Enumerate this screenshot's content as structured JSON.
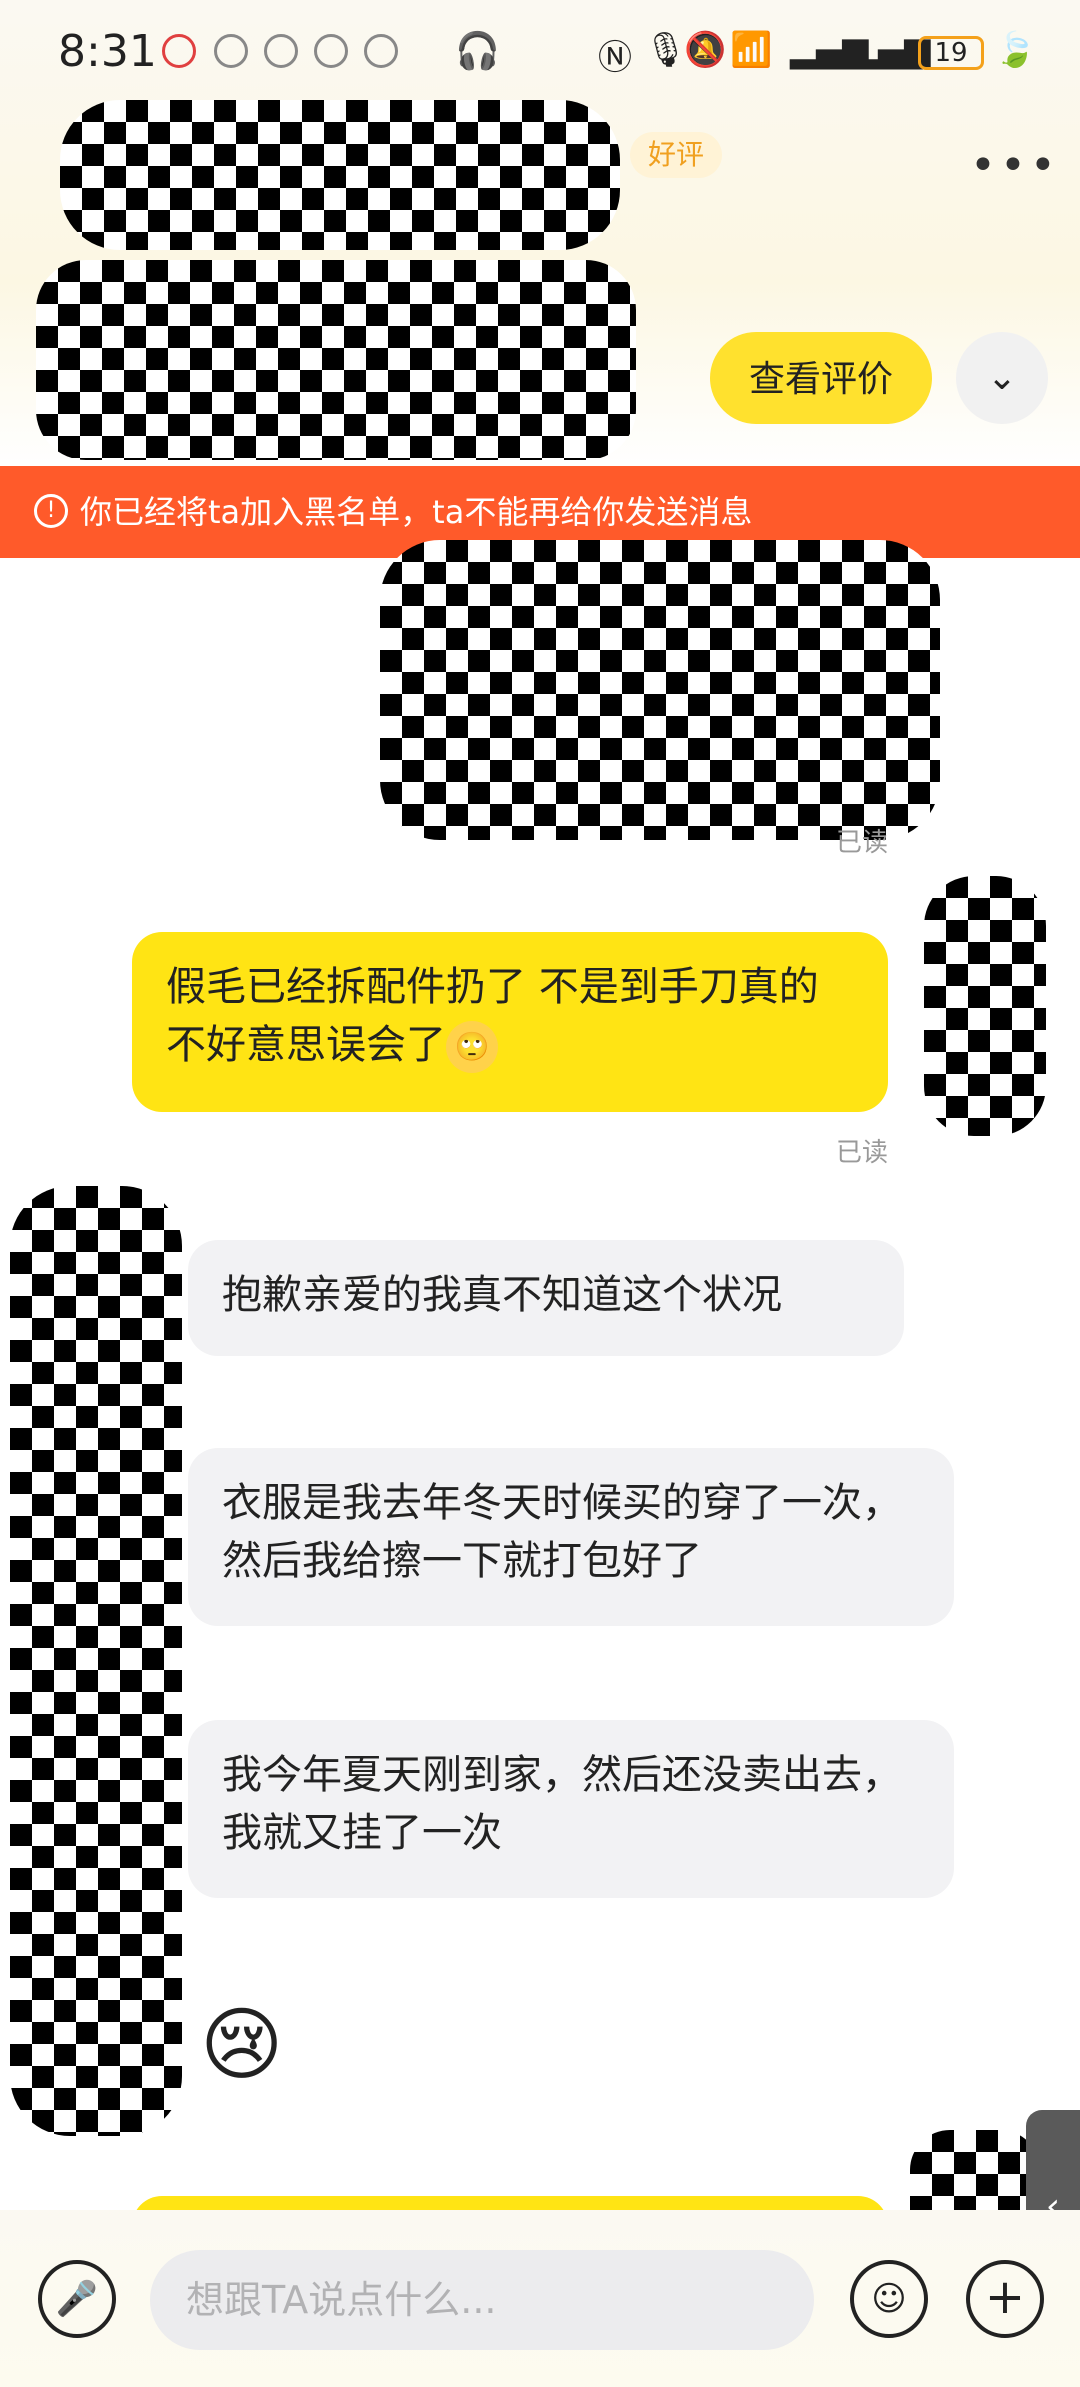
{
  "status_bar": {
    "time": "8:31",
    "battery": "19"
  },
  "header": {
    "badge": "好评",
    "more": "•••",
    "review_button": "查看评价",
    "chevron": "⌄"
  },
  "banner": {
    "icon": "!",
    "text": "你已经将ta加入黑名单，ta不能再给你发送消息"
  },
  "messages": [
    {
      "side": "mine",
      "kind": "image",
      "status": "已读"
    },
    {
      "side": "mine",
      "kind": "text",
      "text": "假毛已经拆配件扔了 不是到手刀真的不好意思误会了",
      "emoji": "🙄",
      "status": "已读"
    },
    {
      "side": "theirs",
      "kind": "text",
      "text": "抱歉亲爱的我真不知道这个状况"
    },
    {
      "side": "theirs",
      "kind": "text",
      "text": "衣服是我去年冬天时候买的穿了一次，然后我给擦一下就打包好了"
    },
    {
      "side": "theirs",
      "kind": "text",
      "text": "我今年夏天刚到家，然后还没卖出去，我就又挂了一次"
    },
    {
      "side": "theirs",
      "kind": "sticker",
      "emoji": "😢"
    }
  ],
  "input": {
    "placeholder": "想跟TA说点什么..."
  },
  "icons": {
    "mic": "mic-icon",
    "emoji": "emoji-icon",
    "plus": "plus-icon",
    "side_tab": "chevron-left-icon"
  },
  "colors": {
    "accent_yellow": "#ffe414",
    "banner_red": "#ff5a2a",
    "bubble_gray": "#f2f2f4"
  }
}
